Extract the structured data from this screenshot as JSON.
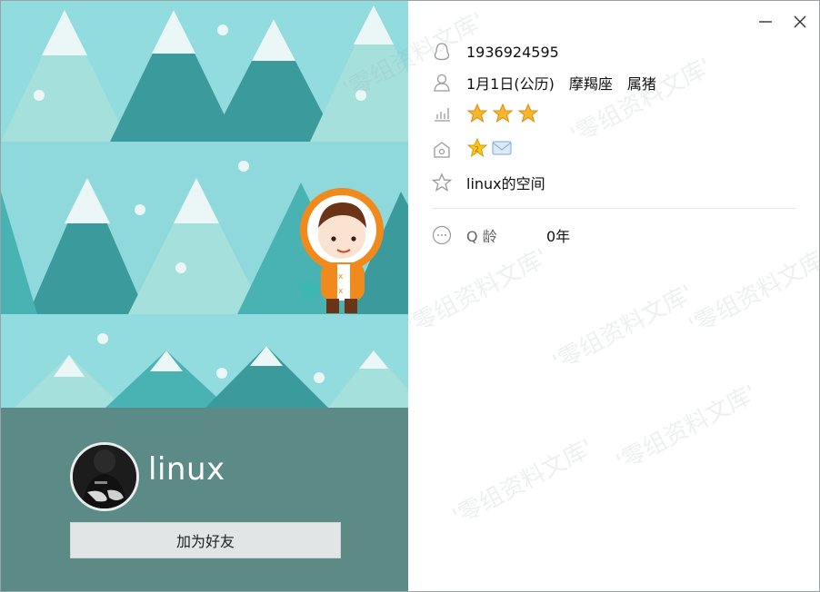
{
  "profile": {
    "nickname": "linux",
    "add_friend_label": "加为好友"
  },
  "info": {
    "qq_number": "1936924595",
    "birthday": "1月1日(公历)",
    "constellation": "摩羯座",
    "zodiac": "属猪",
    "space_link": "linux的空间",
    "qage_label": "Q 龄",
    "qage_value": "0年"
  },
  "level": {
    "stars": 3
  },
  "watermark": {
    "text": "'零组资料文库'"
  },
  "colors": {
    "sky": "#8fd9dc",
    "tree_dark": "#3a9a9c",
    "tree_mid": "#49b3b4",
    "tree_light": "#a6e0dc",
    "snow": "#eaf7f6",
    "bottom_panel": "#5b8a87",
    "button": "#e1e5e6"
  }
}
